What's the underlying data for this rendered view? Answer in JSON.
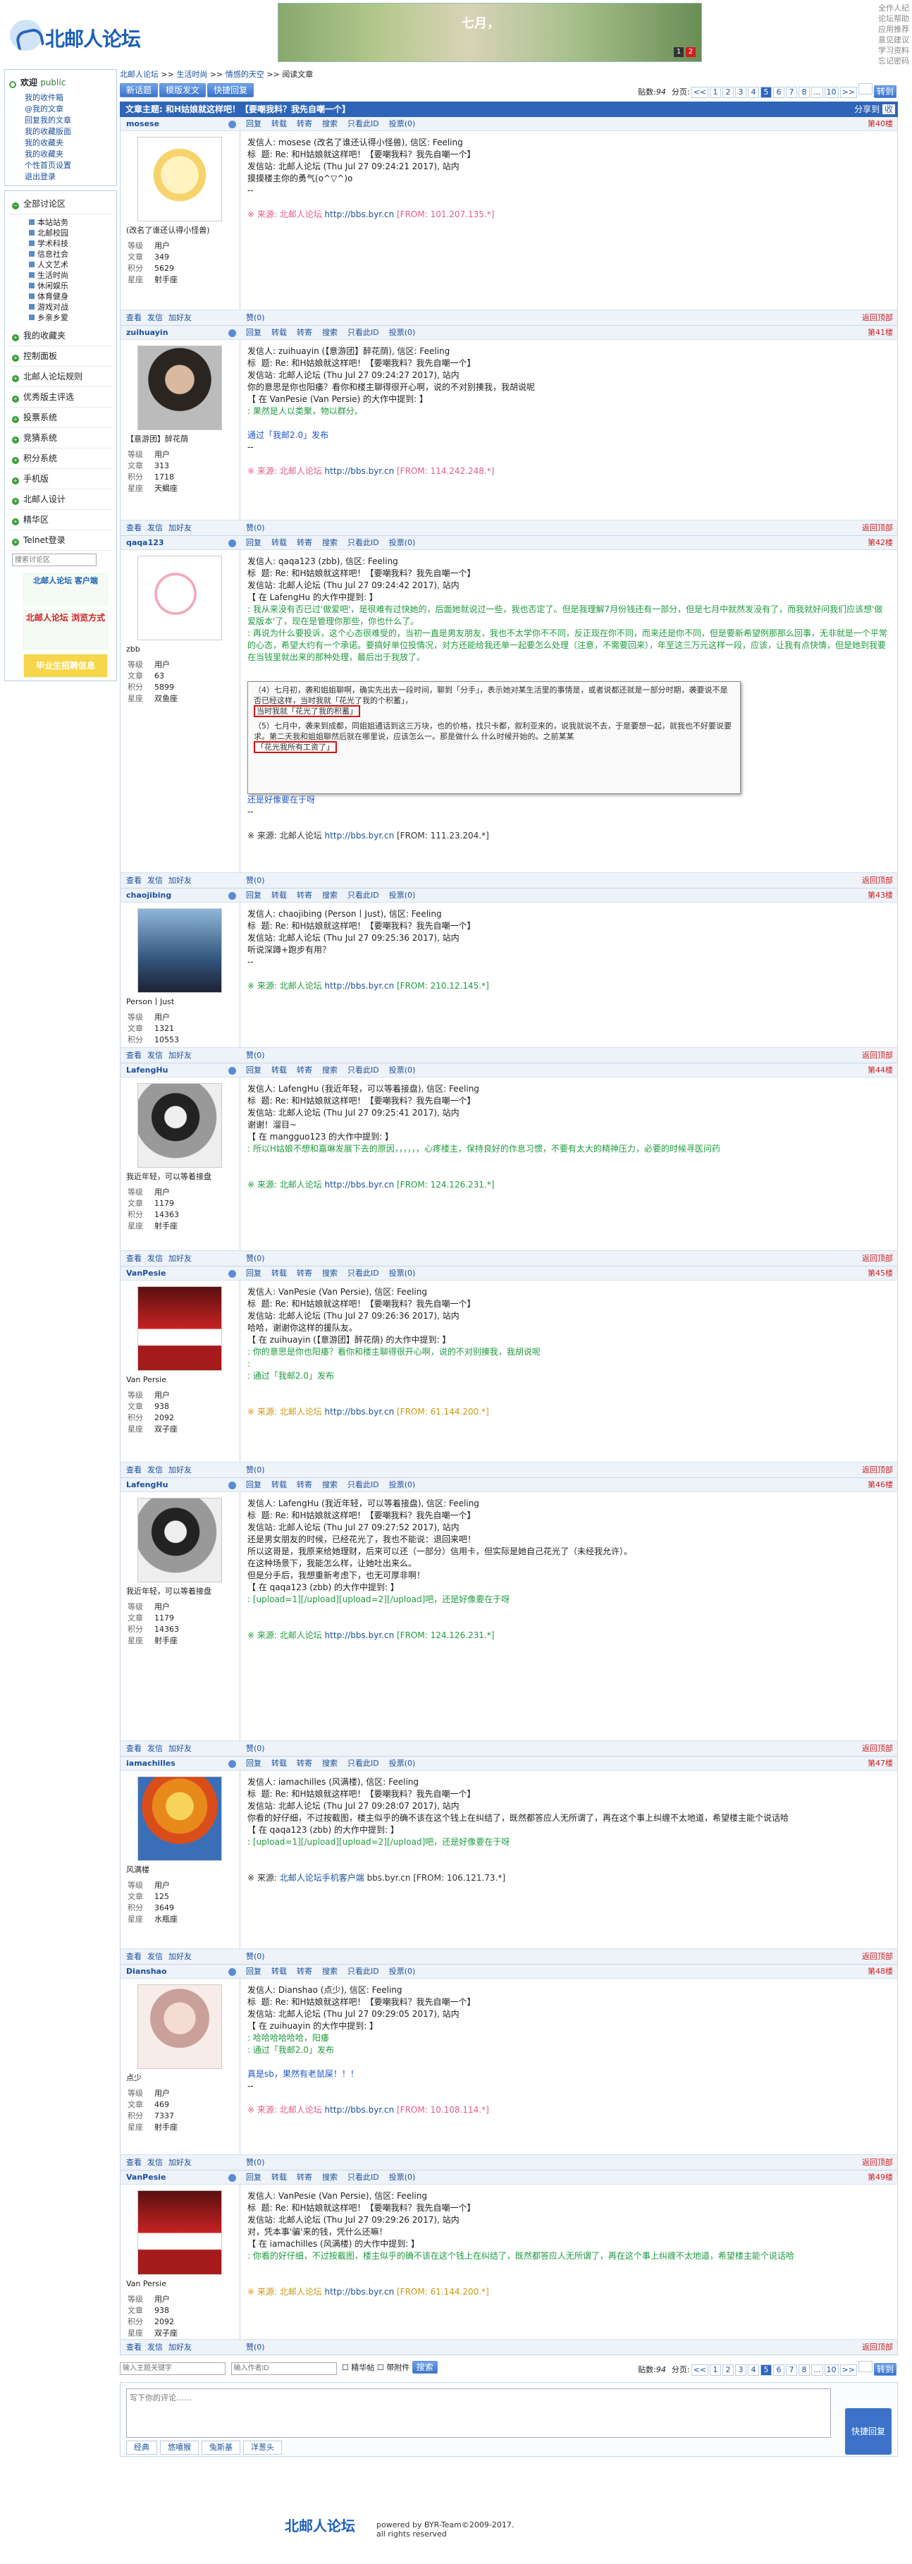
{
  "header": {
    "logo_text": "北邮人论坛",
    "banner_text": "七月，",
    "banner_pages": [
      "1",
      "2"
    ],
    "toplinks": [
      "全作人纪",
      "论坛帮助",
      "应用推荐",
      "意见建议",
      "学习资料",
      "忘记密码"
    ]
  },
  "sidebar": {
    "welcome": "欢迎",
    "welcome_user": "public",
    "user_links": [
      "我的收件箱",
      "@我的文章",
      "回复我的文章",
      "我的收藏版面",
      "我的收藏夹",
      "我的收藏夹",
      "个性首页设置",
      "退出登录"
    ],
    "nav_title": "全部讨论区",
    "sections": [
      "本站站务",
      "北邮校园",
      "学术科技",
      "信息社会",
      "人文艺术",
      "生活时尚",
      "休闲娱乐",
      "体育健身",
      "游戏对战",
      "乡亲乡爱"
    ],
    "other": [
      "我的收藏夹",
      "控制面板",
      "北邮人论坛规则",
      "优秀版主评选",
      "投票系统",
      "竞猜系统",
      "积分系统",
      "手机版",
      "北邮人设计",
      "精华区",
      "Telnet登录"
    ],
    "search_placeholder": "搜索讨论区",
    "badge1": "北邮人论坛 客户端",
    "badge2": "北邮人论坛 浏览方式",
    "badge3": "毕业生招聘信息"
  },
  "crumb": [
    "北邮人论坛",
    ">>",
    "生活时尚",
    ">>",
    "情感的天空",
    ">>",
    "阅读文章"
  ],
  "toolbar": {
    "new": "新话题",
    "mode": "模版发文",
    "quick": "快捷回复",
    "posts_label": "贴数:",
    "posts": "94",
    "pages_label": "分页:",
    "pages": [
      "<<",
      "1",
      "2",
      "3",
      "4",
      "5",
      "6",
      "7",
      "8",
      "...",
      "10",
      ">>"
    ],
    "current": "5",
    "jump": "转到"
  },
  "title": {
    "label": "文章主题: 和H姑娘就这样吧！【要嘲我料？我先自嘲一个】",
    "share": "分享到",
    "ic": "收"
  },
  "post_actions": [
    "回复",
    "转载",
    "转寄",
    "搜索",
    "只看此ID",
    "投票(0)"
  ],
  "footer_actions": [
    "查看",
    "发信",
    "加好友"
  ],
  "like": "赞(0)",
  "back_top": "返回顶部",
  "posts": [
    {
      "id": "mosese",
      "nick": "(改名了谁还认得小怪兽)",
      "floor": "第40楼",
      "level": "用户",
      "articles": "349",
      "score": "5629",
      "star": "射手座",
      "lines": [
        "发信人: mosese (改名了谁还认得小怪兽), 信区: Feeling",
        "标  题: Re: 和H姑娘就这样吧！【要嘲我料？我先自嘲一个】",
        "发信站: 北邮人论坛 (Thu Jul 27 09:24:21 2017), 站内",
        "",
        "摸摸楼主你的勇气(o^▽^)o",
        "--",
        ""
      ],
      "src": "※ 来源: 北邮人论坛 ",
      "src_link": "http://bbs.byr.cn",
      "src_ip": " [FROM: 101.207.135.*]",
      "src_style": "pink"
    },
    {
      "id": "zuihuayin",
      "nick": "【意游团】醉花荫",
      "floor": "第41楼",
      "level": "用户",
      "articles": "313",
      "score": "1718",
      "star": "天蝎座",
      "lines": [
        "发信人: zuihuayin (【意游团】醉花荫), 信区: Feeling",
        "标  题: Re: 和H姑娘就这样吧！【要嘲我料？我先自嘲一个】",
        "发信站: 北邮人论坛 (Thu Jul 27 09:24:27 2017), 站内",
        "",
        "你的意思是你也阳痿？看你和楼主聊得很开心啊，说的不对别揍我，我胡说呢"
      ],
      "quote": [
        "【 在 VanPesie (Van Persie) 的大作中提到: 】",
        ": 果然是人以类聚，物以群分。"
      ],
      "tail": "通过「我邮2.0」发布",
      "src": "※ 来源: 北邮人论坛 ",
      "src_link": "http://bbs.byr.cn",
      "src_ip": " [FROM: 114.242.248.*]",
      "src_style": "pink"
    },
    {
      "id": "qaqa123",
      "nick": "zbb",
      "floor": "第42楼",
      "level": "用户",
      "articles": "63",
      "score": "5899",
      "star": "双鱼座",
      "lines": [
        "发信人: qaqa123 (zbb), 信区: Feeling",
        "标  题: Re: 和H姑娘就这样吧！【要嘲我料？我先自嘲一个】",
        "发信站: 北邮人论坛 (Thu Jul 27 09:24:42 2017), 站内",
        "",
        ""
      ],
      "quote": [
        "【 在 LafengHu 的大作中提到: 】",
        ": 我从来没有否已过'做爱吧'，是很难有过快她的，后面她就说过一些，我也否定了。但是我理解7月份钱还有一部分，但是七月中就然发没有了，而我就好问我们应该想'做爱版本'了，现在是管理你那些，你也什么了。",
        ": 再说为什么要投诉，这个心态很难受的，当初一直是男友朋友，我也不太学你不不同，反正现在你不同，而来还是你不同，但是要新希望例那那么回事，无非就是一个平常的心态，希望大约有一个承诺。要搞好单位投情况，对方还能给我还单一起要怎么处理（注意，不需要回来），年至这三万元这样一段，应该，让我有点快情，但是她到我要在当钱里就出来的那种处理，最后出于我放了。"
      ],
      "embed": true,
      "embed_lines": [
        "（4）七月初，袭和姐姐聊啊，确实先出去一段时间，聊到「分手」，表示她对某生活里的事情是，或者说都还就是一部分时期，袭要说不是否已经这样，当时我就「花光了我的个积蓄」，",
        "（5）七月中，袭来到成都，同姐姐通话到这三万块，也的价格，找只卡都，叙利亚来的，说我就说不去，于是要想一起，就我也不好要说要求。第二天我和姐姐聊然后就在哪里说，应该怎么一。那是做什么 什么时候开始的。之前某某"
      ],
      "embed_hl1": "当时我就「花光了我的积蓄」",
      "embed_hl2": "「花光我所有工资了」",
      "tail": "还是好像要在于呀",
      "src": "※ 来源: 北邮人论坛 ",
      "src_link": "http://bbs.byr.cn",
      "src_ip": " [FROM: 111.23.204.*]",
      "src_style": "plain"
    },
    {
      "id": "chaojibing",
      "nick": "Person丨Just",
      "floor": "第43楼",
      "level": "用户",
      "articles": "1321",
      "score": "10553",
      "star": "双鱼座",
      "lines": [
        "发信人: chaojibing (Person丨Just), 信区: Feeling",
        "标  题: Re: 和H姑娘就这样吧！【要嘲我料？我先自嘲一个】",
        "发信站: 北邮人论坛 (Thu Jul 27 09:25:36 2017), 站内",
        "",
        "听说深蹲+跑步有用？",
        "--"
      ],
      "src": "※ 来源: 北邮人论坛 ",
      "src_link": "http://bbs.byr.cn",
      "src_ip": " [FROM: 210.12.145.*]",
      "src_style": "green"
    },
    {
      "id": "LafengHu",
      "nick": "我近年轻，可以等着接盘",
      "floor": "第44楼",
      "level": "用户",
      "articles": "1179",
      "score": "14363",
      "star": "射手座",
      "lines": [
        "发信人: LafengHu (我近年轻，可以等着接盘), 信区: Feeling",
        "标  题: Re: 和H姑娘就这样吧！【要嘲我料？我先自嘲一个】",
        "发信站: 北邮人论坛 (Thu Jul 27 09:25:41 2017), 站内",
        "",
        "谢谢！溜目~",
        ""
      ],
      "quote": [
        "【 在 mangguo123 的大作中提到: 】",
        ": 所以H姑娘不想和嘉琳发展下去的原因，，，，，，心疼楼主，保持良好的作息习惯，不要有太大的精神压力，必要的时候寻医问药"
      ],
      "src": "※ 来源: 北邮人论坛 ",
      "src_link": "http://bbs.byr.cn",
      "src_ip": " [FROM: 124.126.231.*]",
      "src_style": "green"
    },
    {
      "id": "VanPesie",
      "nick": "Van Persie",
      "floor": "第45楼",
      "level": "用户",
      "articles": "938",
      "score": "2092",
      "star": "双子座",
      "lines": [
        "发信人: VanPesie (Van Persie), 信区: Feeling",
        "标  题: Re: 和H姑娘就这样吧！【要嘲我料？我先自嘲一个】",
        "发信站: 北邮人论坛 (Thu Jul 27 09:26:36 2017), 站内",
        "",
        "哈哈，谢谢你这样的援队友。"
      ],
      "quote": [
        "【 在 zuihuayin (【意游团】醉花荫) 的大作中提到: 】",
        ": 你的意思是你也阳痿？看你和楼主聊得很开心啊，说的不对别揍我，我胡说呢",
        ": ",
        ": 通过「我邮2.0」发布"
      ],
      "src": "※ 来源: 北邮人论坛 ",
      "src_link": "http://bbs.byr.cn",
      "src_ip": " [FROM: 61.144.200.*]",
      "src_style": "yellow"
    },
    {
      "id": "LafengHu",
      "nick": "我近年轻，可以等着接盘",
      "floor": "第46楼",
      "level": "用户",
      "articles": "1179",
      "score": "14363",
      "star": "射手座",
      "lines": [
        "发信人: LafengHu (我近年轻，可以等着接盘), 信区: Feeling",
        "标  题: Re: 和H姑娘就这样吧！【要嘲我料？我先自嘲一个】",
        "发信站: 北邮人论坛 (Thu Jul 27 09:27:52 2017), 站内",
        "",
        "还是男女朋友的时候，已经花光了，我也不能说：退回来吧！",
        "",
        "所以这哥是，我原来给她理财，后来可以还（一部分）信用卡，但实际是她自己花光了（未经我允许）。",
        "",
        "在这种场景下，我能怎么样，让她吐出来么。",
        "",
        "但是分手后，我想重新考虑下，也无可厚非啊！",
        ""
      ],
      "quote": [
        "【 在 qaqa123 (zbb) 的大作中提到: 】",
        ": [upload=1][/upload][upload=2][/upload]吧，还是好像要在于呀"
      ],
      "src": "※ 来源: 北邮人论坛 ",
      "src_link": "http://bbs.byr.cn",
      "src_ip": " [FROM: 124.126.231.*]",
      "src_style": "green"
    },
    {
      "id": "iamachilles",
      "nick": "风满楼",
      "floor": "第47楼",
      "level": "用户",
      "articles": "125",
      "score": "3649",
      "star": "水瓶座",
      "lines": [
        "发信人: iamachilles (风满楼), 信区: Feeling",
        "标  题: Re: 和H姑娘就这样吧！【要嘲我料？我先自嘲一个】",
        "发信站: 北邮人论坛 (Thu Jul 27 09:28:07 2017), 站内",
        "",
        "你看的好仔细，不过按截图，楼主似乎的确不该在这个钱上在纠结了，既然都答应人无所谓了，再在这个事上纠缠不太地道，希望楼主能个说话哈",
        ""
      ],
      "quote": [
        "【 在 qaqa123 (zbb) 的大作中提到: 】",
        ": [upload=1][/upload][upload=2][/upload]吧，还是好像要在于呀"
      ],
      "src": "※ 来源: ",
      "src_link": "北邮人论坛手机客户端",
      "src_ip": " bbs.byr.cn [FROM: 106.121.73.*]",
      "src_style": "plain"
    },
    {
      "id": "Dianshao",
      "nick": "点少",
      "floor": "第48楼",
      "level": "用户",
      "articles": "469",
      "score": "7337",
      "star": "射手座",
      "lines": [
        "发信人: Dianshao (点少), 信区: Feeling",
        "标  题: Re: 和H姑娘就这样吧！【要嘲我料？我先自嘲一个】",
        "发信站: 北邮人论坛 (Thu Jul 27 09:29:05 2017), 站内",
        "",
        ""
      ],
      "quote": [
        "【 在 zuihuayin 的大作中提到: 】",
        ": 哈哈哈哈哈哈，阳痿",
        ": 通过「我邮2.0」发布"
      ],
      "tail": "真是sb，果然有老鼠屎！！！",
      "src": "※ 来源: 北邮人论坛 ",
      "src_link": "http://bbs.byr.cn",
      "src_ip": " [FROM: 10.108.114.*]",
      "src_style": "pink"
    },
    {
      "id": "VanPesie",
      "nick": "Van Persie",
      "floor": "第49楼",
      "level": "用户",
      "articles": "938",
      "score": "2092",
      "star": "双子座",
      "lines": [
        "发信人: VanPesie (Van Persie), 信区: Feeling",
        "标  题: Re: 和H姑娘就这样吧！【要嘲我料？我先自嘲一个】",
        "发信站: 北邮人论坛 (Thu Jul 27 09:29:26 2017), 站内",
        "",
        "对，凭本事'骗'来的钱，凭什么还嘛！"
      ],
      "quote": [
        "【 在 iamachilles (风满楼) 的大作中提到: 】",
        ": 你看的好仔细，不过按截图，楼主似乎的确不该在这个钱上在纠结了，既然都答应人无所谓了，再在这个事上纠缠不太地道，希望楼主能个说话哈"
      ],
      "src": "※ 来源: 北邮人论坛 ",
      "src_link": "http://bbs.byr.cn",
      "src_ip": " [FROM: 61.144.200.*]",
      "src_style": "yellow"
    }
  ],
  "bottom": {
    "search_author_ph": "输入主题关键字",
    "search_id_ph": "输入作者ID",
    "cb1": "精华帖",
    "cb2": "带附件",
    "go": "搜索"
  },
  "reply": {
    "placeholder": "写下你的评论……",
    "send": "快捷回复",
    "tabs": [
      "经典",
      "悠嘻猴",
      "兔斯基",
      "洋葱头"
    ]
  },
  "footer": {
    "logo": "北邮人论坛",
    "line1": "powered by BYR-Team©2009-2017.",
    "line2": "all rights reserved"
  },
  "colors": {
    "accent": "#2e65b8",
    "quote": "#1f9b3f",
    "source": "#e05c8a",
    "highlight": "#d11"
  }
}
